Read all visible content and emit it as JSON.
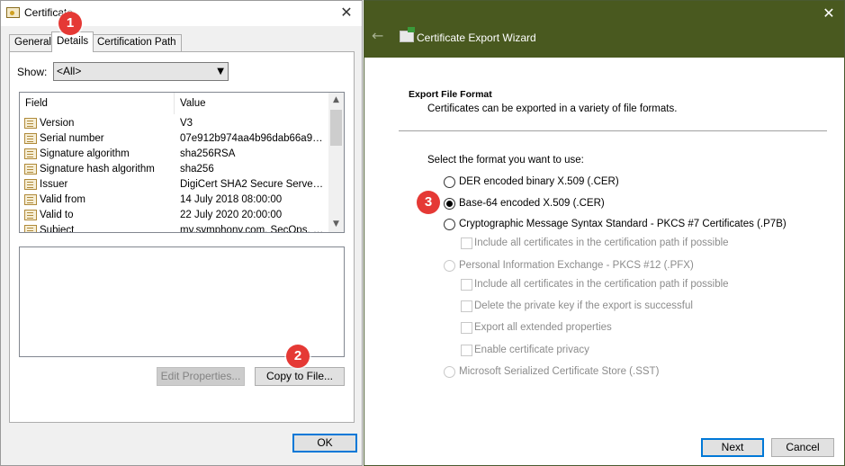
{
  "certificate": {
    "title": "Certificate",
    "close_glyph": "✕",
    "tabs": [
      {
        "label": "General"
      },
      {
        "label": "Details",
        "selected": true
      },
      {
        "label": "Certification Path"
      }
    ],
    "show": {
      "label": "Show:",
      "value": "<All>"
    },
    "list": {
      "columns": [
        "Field",
        "Value"
      ],
      "rows": [
        {
          "field": "Version",
          "value": "V3"
        },
        {
          "field": "Serial number",
          "value": "07e912b974aa4b96dab66a92..."
        },
        {
          "field": "Signature algorithm",
          "value": "sha256RSA"
        },
        {
          "field": "Signature hash algorithm",
          "value": "sha256"
        },
        {
          "field": "Issuer",
          "value": "DigiCert SHA2 Secure Server ..."
        },
        {
          "field": "Valid from",
          "value": "14 July 2018 08:00:00"
        },
        {
          "field": "Valid to",
          "value": "22 July 2020 20:00:00"
        },
        {
          "field": "Subject",
          "value": "my.symphony.com, SecOps, S..."
        }
      ]
    },
    "buttons": {
      "edit_properties": "Edit Properties...",
      "copy_to_file": "Copy to File...",
      "ok": "OK"
    }
  },
  "wizard": {
    "title": "Certificate Export Wizard",
    "close_glyph": "✕",
    "back_glyph": "←",
    "header_color": "#49591f",
    "section_title": "Export File Format",
    "section_subtitle": "Certificates can be exported in a variety of file formats.",
    "choose_label": "Select the format you want to use:",
    "formats": [
      {
        "label": "DER encoded binary X.509 (.CER)",
        "checked": false,
        "enabled": true
      },
      {
        "label": "Base-64 encoded X.509 (.CER)",
        "checked": true,
        "enabled": true
      },
      {
        "label": "Cryptographic Message Syntax Standard - PKCS #7 Certificates (.P7B)",
        "checked": false,
        "enabled": true
      },
      {
        "label": "Personal Information Exchange - PKCS #12 (.PFX)",
        "checked": false,
        "enabled": false
      },
      {
        "label": "Microsoft Serialized Certificate Store (.SST)",
        "checked": false,
        "enabled": false
      }
    ],
    "p7b_options": [
      {
        "label": "Include all certificates in the certification path if possible",
        "checked": false,
        "enabled": false
      }
    ],
    "pfx_options": [
      {
        "label": "Include all certificates in the certification path if possible",
        "checked": false,
        "enabled": false
      },
      {
        "label": "Delete the private key if the export is successful",
        "checked": false,
        "enabled": false
      },
      {
        "label": "Export all extended properties",
        "checked": false,
        "enabled": false
      },
      {
        "label": "Enable certificate privacy",
        "checked": false,
        "enabled": false
      }
    ],
    "buttons": {
      "next": "Next",
      "cancel": "Cancel"
    }
  },
  "annotations": {
    "badge_color": "#e53935",
    "badges": [
      "1",
      "2",
      "3"
    ]
  }
}
